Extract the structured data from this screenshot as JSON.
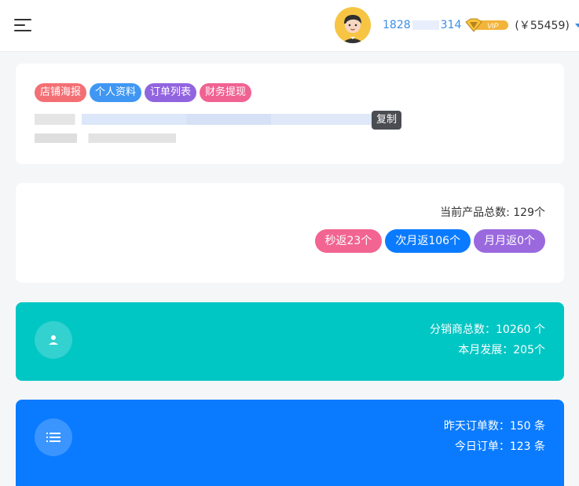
{
  "header": {
    "phone_prefix": "1828",
    "phone_suffix": "314",
    "vip_label": "VIP",
    "balance": "(￥55459)"
  },
  "shop_card": {
    "tags": [
      "店铺海报",
      "个人资料",
      "订单列表",
      "财务提现"
    ],
    "copy_label": "复制"
  },
  "product_card": {
    "total_text": "当前产品总数: 129个",
    "buttons": [
      "秒返23个",
      "次月返106个",
      "月月返0个"
    ]
  },
  "distributor_card": {
    "line1": "分销商总数：10260 个",
    "line2": "本月发展：205个"
  },
  "order_card": {
    "line1": "昨天订单数：150 条",
    "line2": "今日订单：123 条"
  },
  "colors": {
    "teal": "#00c6c4",
    "blue": "#0a7bff",
    "pink": "#f26491",
    "purple": "#9a69de"
  }
}
